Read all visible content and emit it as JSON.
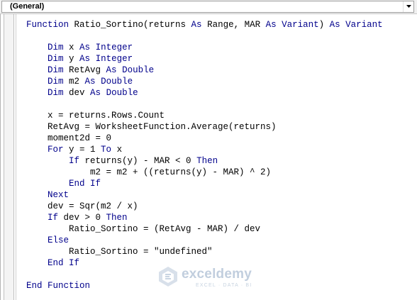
{
  "procedure_dropdown": {
    "selected": "(General)",
    "arrow_icon": "chevron-down-icon"
  },
  "code_lines": [
    [
      {
        "t": "Function",
        "k": true
      },
      {
        "t": " Ratio_Sortino(returns "
      },
      {
        "t": "As",
        "k": true
      },
      {
        "t": " Range, MAR "
      },
      {
        "t": "As",
        "k": true
      },
      {
        "t": " "
      },
      {
        "t": "Variant",
        "k": true
      },
      {
        "t": ") "
      },
      {
        "t": "As",
        "k": true
      },
      {
        "t": " "
      },
      {
        "t": "Variant",
        "k": true
      }
    ],
    [],
    [
      {
        "t": "    "
      },
      {
        "t": "Dim",
        "k": true
      },
      {
        "t": " x "
      },
      {
        "t": "As",
        "k": true
      },
      {
        "t": " "
      },
      {
        "t": "Integer",
        "k": true
      }
    ],
    [
      {
        "t": "    "
      },
      {
        "t": "Dim",
        "k": true
      },
      {
        "t": " y "
      },
      {
        "t": "As",
        "k": true
      },
      {
        "t": " "
      },
      {
        "t": "Integer",
        "k": true
      }
    ],
    [
      {
        "t": "    "
      },
      {
        "t": "Dim",
        "k": true
      },
      {
        "t": " RetAvg "
      },
      {
        "t": "As",
        "k": true
      },
      {
        "t": " "
      },
      {
        "t": "Double",
        "k": true
      }
    ],
    [
      {
        "t": "    "
      },
      {
        "t": "Dim",
        "k": true
      },
      {
        "t": " m2 "
      },
      {
        "t": "As",
        "k": true
      },
      {
        "t": " "
      },
      {
        "t": "Double",
        "k": true
      }
    ],
    [
      {
        "t": "    "
      },
      {
        "t": "Dim",
        "k": true
      },
      {
        "t": " dev "
      },
      {
        "t": "As",
        "k": true
      },
      {
        "t": " "
      },
      {
        "t": "Double",
        "k": true
      }
    ],
    [],
    [
      {
        "t": "    x = returns.Rows.Count"
      }
    ],
    [
      {
        "t": "    RetAvg = WorksheetFunction.Average(returns)"
      }
    ],
    [
      {
        "t": "    moment2d = 0"
      }
    ],
    [
      {
        "t": "    "
      },
      {
        "t": "For",
        "k": true
      },
      {
        "t": " y = 1 "
      },
      {
        "t": "To",
        "k": true
      },
      {
        "t": " x"
      }
    ],
    [
      {
        "t": "        "
      },
      {
        "t": "If",
        "k": true
      },
      {
        "t": " returns(y) - MAR < 0 "
      },
      {
        "t": "Then",
        "k": true
      }
    ],
    [
      {
        "t": "            m2 = m2 + ((returns(y) - MAR) ^ 2)"
      }
    ],
    [
      {
        "t": "        "
      },
      {
        "t": "End If",
        "k": true
      }
    ],
    [
      {
        "t": "    "
      },
      {
        "t": "Next",
        "k": true
      }
    ],
    [
      {
        "t": "    dev = Sqr(m2 / x)"
      }
    ],
    [
      {
        "t": "    "
      },
      {
        "t": "If",
        "k": true
      },
      {
        "t": " dev > 0 "
      },
      {
        "t": "Then",
        "k": true
      }
    ],
    [
      {
        "t": "        Ratio_Sortino = (RetAvg - MAR) / dev"
      }
    ],
    [
      {
        "t": "    "
      },
      {
        "t": "Else",
        "k": true
      }
    ],
    [
      {
        "t": "        Ratio_Sortino = \"undefined\""
      }
    ],
    [
      {
        "t": "    "
      },
      {
        "t": "End If",
        "k": true
      }
    ],
    [],
    [
      {
        "t": "End Function",
        "k": true
      }
    ]
  ],
  "colors": {
    "keyword": "#00008b",
    "text": "#000000",
    "editor_background": "#ffffff"
  },
  "watermark": {
    "brand": "exceldemy",
    "tagline": "EXCEL · DATA · BI",
    "icon": "exceldemy-logo-icon"
  }
}
